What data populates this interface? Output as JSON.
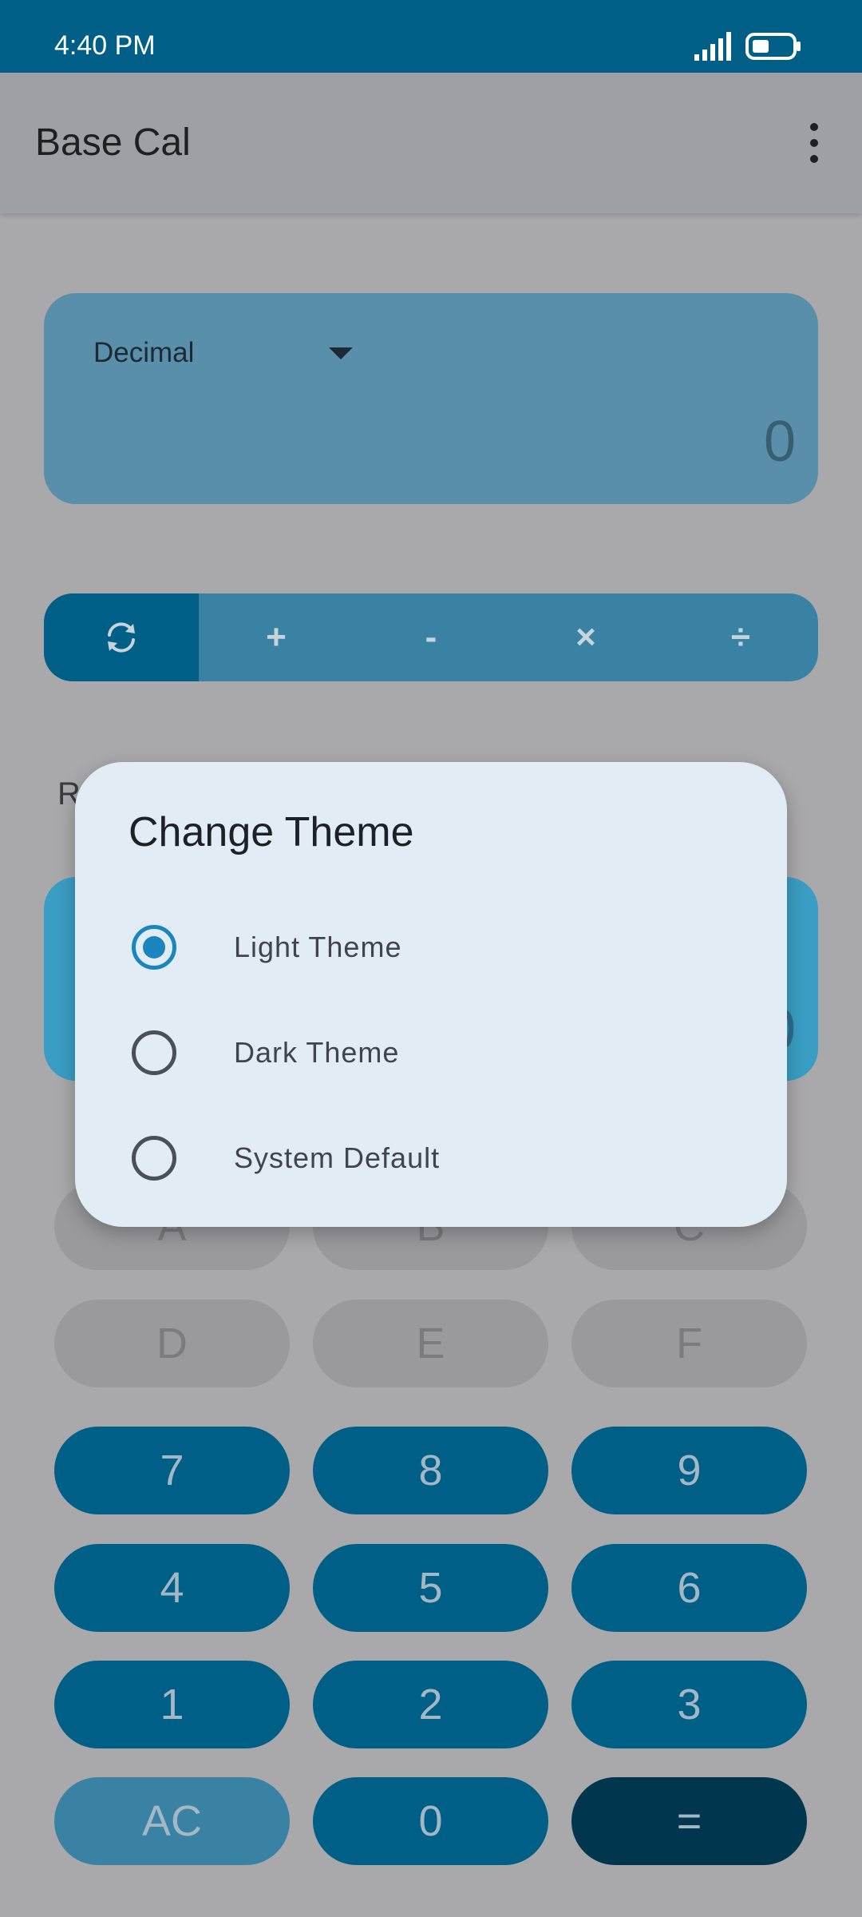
{
  "status_bar": {
    "time": "4:40 PM"
  },
  "app_bar": {
    "title": "Base Cal"
  },
  "input": {
    "base": "Decimal",
    "value": "0"
  },
  "operations": {
    "add": "+",
    "subtract": "-",
    "multiply": "×",
    "divide": "÷"
  },
  "result": {
    "label": "R",
    "value": "0"
  },
  "keypad": {
    "row_hex1": [
      "A",
      "B",
      "C"
    ],
    "row_hex2": [
      "D",
      "E",
      "F"
    ],
    "row_789": [
      "7",
      "8",
      "9"
    ],
    "row_456": [
      "4",
      "5",
      "6"
    ],
    "row_123": [
      "1",
      "2",
      "3"
    ],
    "ac": "AC",
    "zero": "0",
    "equals": "="
  },
  "dialog": {
    "title": "Change Theme",
    "options": [
      {
        "label": "Light Theme",
        "selected": true
      },
      {
        "label": "Dark Theme",
        "selected": false
      },
      {
        "label": "System Default",
        "selected": false
      }
    ]
  },
  "colors": {
    "primary": "#005f86",
    "dark": "#00374f",
    "accent": "#1a85bf",
    "dialog_bg": "#e2ecf5"
  }
}
